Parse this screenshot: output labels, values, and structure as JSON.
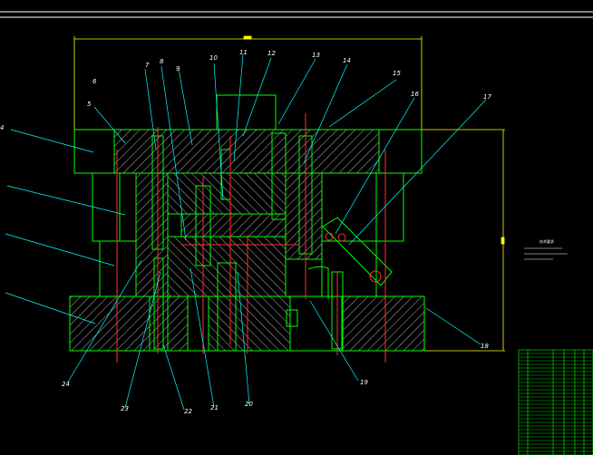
{
  "drawing": {
    "colors": {
      "background": "#000000",
      "outline": "#00ff00",
      "hatch": "#e8e8e8",
      "leader": "#00ffff",
      "center": "#ff3030",
      "dimension": "#ffff00",
      "label": "#ffffff"
    },
    "callouts": [
      {
        "num": "4"
      },
      {
        "num": "5"
      },
      {
        "num": "6"
      },
      {
        "num": "7"
      },
      {
        "num": "8"
      },
      {
        "num": "9"
      },
      {
        "num": "10"
      },
      {
        "num": "11"
      },
      {
        "num": "12"
      },
      {
        "num": "13"
      },
      {
        "num": "14"
      },
      {
        "num": "15"
      },
      {
        "num": "16"
      },
      {
        "num": "17"
      },
      {
        "num": "18"
      },
      {
        "num": "19"
      },
      {
        "num": "20"
      },
      {
        "num": "21"
      },
      {
        "num": "22"
      },
      {
        "num": "23"
      },
      {
        "num": "24"
      }
    ],
    "notes": {
      "title": "技术要求",
      "items": []
    }
  }
}
